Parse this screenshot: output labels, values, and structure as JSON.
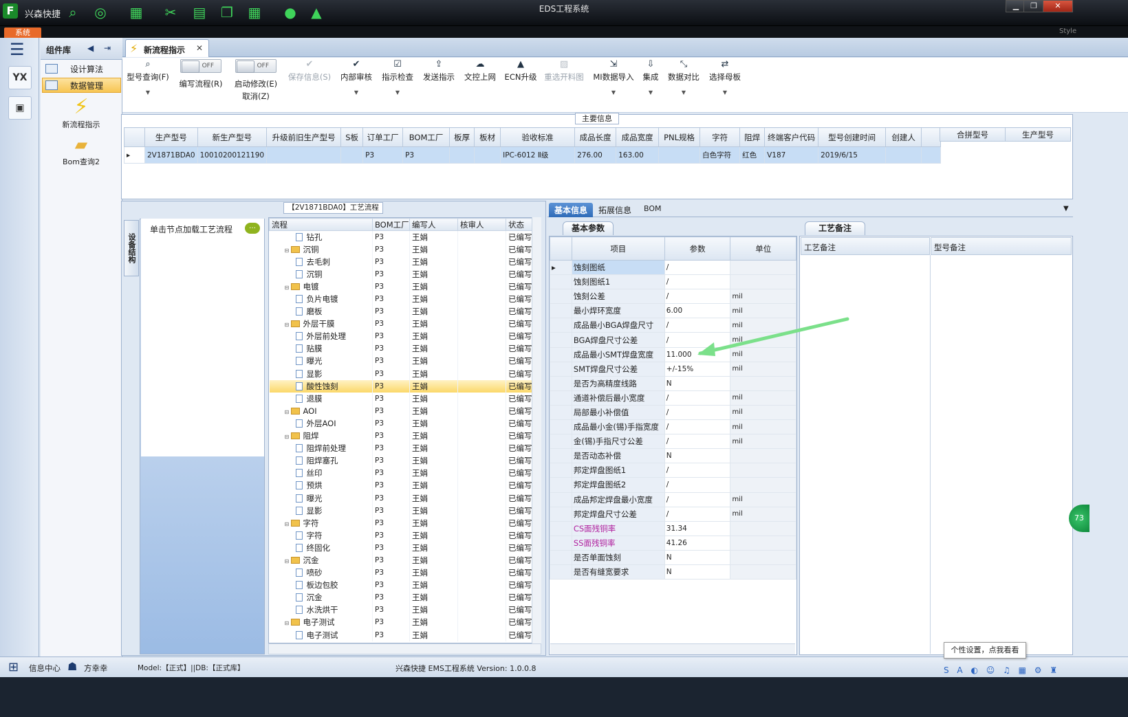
{
  "window": {
    "title": "EDS工程系统",
    "app_name": "兴森快捷",
    "logo": "F",
    "system_tab": "系统",
    "style_label": "Style"
  },
  "toolbar_icons": [
    "search-icon",
    "globe-icon",
    "grid-icon",
    "scissors-icon",
    "film-icon",
    "copy-icon",
    "apps-icon",
    "user-icon",
    "chart-icon"
  ],
  "rail": {
    "items": [
      "YX",
      "calc"
    ]
  },
  "library": {
    "title": "组件库",
    "items": [
      {
        "label": "设计算法"
      },
      {
        "label": "数据管理"
      }
    ],
    "apps": [
      {
        "label": "新流程指示"
      },
      {
        "label": "Bom查询2"
      }
    ]
  },
  "tab": {
    "label": "新流程指示"
  },
  "toolbar": {
    "query": "型号查询(F)",
    "write_flow": "编写流程(R)",
    "enable_modify": "启动修改(E)",
    "cancel": "取消(Z)",
    "toggle_off": "OFF",
    "save": "保存信息(S)",
    "internal_review": "内部审核",
    "instruction_check": "指示检查",
    "send_instruction": "发送指示",
    "doc_upload": "文控上网",
    "ecn_upgrade": "ECN升级",
    "reselect_drawing": "重选开料图",
    "mi_import": "MI数据导入",
    "integration": "集成",
    "data_compare": "数据对比",
    "select_mother": "选择母板"
  },
  "main_info": {
    "title": "主要信息",
    "columns": [
      "生产型号",
      "新生产型号",
      "升级前旧生产型号",
      "S板",
      "订单工厂",
      "BOM工厂",
      "板厚",
      "板材",
      "验收标准",
      "成品长度",
      "成品宽度",
      "PNL规格",
      "字符",
      "阻焊",
      "终端客户代码",
      "型号创建时间",
      "创建人"
    ],
    "row": [
      "2V1871BDA0",
      "10010200121190",
      "",
      "",
      "P3",
      "P3",
      "",
      "",
      "IPC-6012 Ⅱ级",
      "276.00",
      "163.00",
      "",
      "白色字符",
      "红色",
      "V187",
      "2019/6/15",
      ""
    ],
    "merge_columns": [
      "合拼型号",
      "生产型号"
    ]
  },
  "process": {
    "title": "【2V1871BDA0】工艺流程",
    "side_tab": "设备结构",
    "hint": "单击节点加载工艺流程",
    "columns": [
      "流程",
      "BOM工厂",
      "编写人",
      "核审人",
      "状态"
    ],
    "rows": [
      {
        "name": "钻孔",
        "level": 2,
        "bom": "P3",
        "writer": "王娟",
        "reviewer": "",
        "status": "已编写"
      },
      {
        "name": "沉铜",
        "level": 1,
        "bom": "P3",
        "writer": "王娟",
        "reviewer": "",
        "status": "已编写"
      },
      {
        "name": "去毛刺",
        "level": 2,
        "bom": "P3",
        "writer": "王娟",
        "reviewer": "",
        "status": "已编写"
      },
      {
        "name": "沉铜",
        "level": 2,
        "bom": "P3",
        "writer": "王娟",
        "reviewer": "",
        "status": "已编写"
      },
      {
        "name": "电镀",
        "level": 1,
        "bom": "P3",
        "writer": "王娟",
        "reviewer": "",
        "status": "已编写"
      },
      {
        "name": "负片电镀",
        "level": 2,
        "bom": "P3",
        "writer": "王娟",
        "reviewer": "",
        "status": "已编写"
      },
      {
        "name": "磨板",
        "level": 2,
        "bom": "P3",
        "writer": "王娟",
        "reviewer": "",
        "status": "已编写"
      },
      {
        "name": "外层干膜",
        "level": 1,
        "bom": "P3",
        "writer": "王娟",
        "reviewer": "",
        "status": "已编写"
      },
      {
        "name": "外层前处理",
        "level": 2,
        "bom": "P3",
        "writer": "王娟",
        "reviewer": "",
        "status": "已编写"
      },
      {
        "name": "贴膜",
        "level": 2,
        "bom": "P3",
        "writer": "王娟",
        "reviewer": "",
        "status": "已编写"
      },
      {
        "name": "曝光",
        "level": 2,
        "bom": "P3",
        "writer": "王娟",
        "reviewer": "",
        "status": "已编写"
      },
      {
        "name": "显影",
        "level": 2,
        "bom": "P3",
        "writer": "王娟",
        "reviewer": "",
        "status": "已编写"
      },
      {
        "name": "酸性蚀刻",
        "level": 2,
        "bom": "P3",
        "writer": "王娟",
        "reviewer": "",
        "status": "已编写",
        "selected": true
      },
      {
        "name": "退膜",
        "level": 2,
        "bom": "P3",
        "writer": "王娟",
        "reviewer": "",
        "status": "已编写"
      },
      {
        "name": "AOI",
        "level": 1,
        "bom": "P3",
        "writer": "王娟",
        "reviewer": "",
        "status": "已编写"
      },
      {
        "name": "外层AOI",
        "level": 2,
        "bom": "P3",
        "writer": "王娟",
        "reviewer": "",
        "status": "已编写"
      },
      {
        "name": "阻焊",
        "level": 1,
        "bom": "P3",
        "writer": "王娟",
        "reviewer": "",
        "status": "已编写"
      },
      {
        "name": "阻焊前处理",
        "level": 2,
        "bom": "P3",
        "writer": "王娟",
        "reviewer": "",
        "status": "已编写"
      },
      {
        "name": "阻焊塞孔",
        "level": 2,
        "bom": "P3",
        "writer": "王娟",
        "reviewer": "",
        "status": "已编写"
      },
      {
        "name": "丝印",
        "level": 2,
        "bom": "P3",
        "writer": "王娟",
        "reviewer": "",
        "status": "已编写"
      },
      {
        "name": "预烘",
        "level": 2,
        "bom": "P3",
        "writer": "王娟",
        "reviewer": "",
        "status": "已编写"
      },
      {
        "name": "曝光",
        "level": 2,
        "bom": "P3",
        "writer": "王娟",
        "reviewer": "",
        "status": "已编写"
      },
      {
        "name": "显影",
        "level": 2,
        "bom": "P3",
        "writer": "王娟",
        "reviewer": "",
        "status": "已编写"
      },
      {
        "name": "字符",
        "level": 1,
        "bom": "P3",
        "writer": "王娟",
        "reviewer": "",
        "status": "已编写"
      },
      {
        "name": "字符",
        "level": 2,
        "bom": "P3",
        "writer": "王娟",
        "reviewer": "",
        "status": "已编写"
      },
      {
        "name": "终固化",
        "level": 2,
        "bom": "P3",
        "writer": "王娟",
        "reviewer": "",
        "status": "已编写"
      },
      {
        "name": "沉金",
        "level": 1,
        "bom": "P3",
        "writer": "王娟",
        "reviewer": "",
        "status": "已编写"
      },
      {
        "name": "喷砂",
        "level": 2,
        "bom": "P3",
        "writer": "王娟",
        "reviewer": "",
        "status": "已编写"
      },
      {
        "name": "板边包胶",
        "level": 2,
        "bom": "P3",
        "writer": "王娟",
        "reviewer": "",
        "status": "已编写"
      },
      {
        "name": "沉金",
        "level": 2,
        "bom": "P3",
        "writer": "王娟",
        "reviewer": "",
        "status": "已编写"
      },
      {
        "name": "水洗烘干",
        "level": 2,
        "bom": "P3",
        "writer": "王娟",
        "reviewer": "",
        "status": "已编写"
      },
      {
        "name": "电子测试",
        "level": 1,
        "bom": "P3",
        "writer": "王娟",
        "reviewer": "",
        "status": "已编写"
      },
      {
        "name": "电子测试",
        "level": 2,
        "bom": "P3",
        "writer": "王娟",
        "reviewer": "",
        "status": "已编写"
      }
    ]
  },
  "info_tabs": [
    "基本信息",
    "拓展信息",
    "BOM"
  ],
  "basic_params": {
    "title": "基本参数",
    "columns": [
      "项目",
      "参数",
      "单位"
    ],
    "rows": [
      {
        "item": "蚀刻图纸",
        "value": "/",
        "unit": "",
        "current": true
      },
      {
        "item": "蚀刻图纸1",
        "value": "/",
        "unit": ""
      },
      {
        "item": "蚀刻公差",
        "value": "/",
        "unit": "mil"
      },
      {
        "item": "最小焊环宽度",
        "value": "6.00",
        "unit": "mil"
      },
      {
        "item": "成品最小BGA焊盘尺寸",
        "value": "/",
        "unit": "mil"
      },
      {
        "item": "BGA焊盘尺寸公差",
        "value": "/",
        "unit": "mil"
      },
      {
        "item": "成品最小SMT焊盘宽度",
        "value": "11.000",
        "unit": "mil"
      },
      {
        "item": "SMT焊盘尺寸公差",
        "value": "+/-15%",
        "unit": "mil"
      },
      {
        "item": "是否为高精度线路",
        "value": "N",
        "unit": ""
      },
      {
        "item": "通道补偿后最小宽度",
        "value": "/",
        "unit": "mil"
      },
      {
        "item": "局部最小补偿值",
        "value": "/",
        "unit": "mil"
      },
      {
        "item": "成品最小金(锡)手指宽度",
        "value": "/",
        "unit": "mil"
      },
      {
        "item": "金(锡)手指尺寸公差",
        "value": "/",
        "unit": "mil"
      },
      {
        "item": "是否动态补偿",
        "value": "N",
        "unit": ""
      },
      {
        "item": "邦定焊盘图纸1",
        "value": "/",
        "unit": ""
      },
      {
        "item": "邦定焊盘图纸2",
        "value": "/",
        "unit": ""
      },
      {
        "item": "成品邦定焊盘最小宽度",
        "value": "/",
        "unit": "mil"
      },
      {
        "item": "邦定焊盘尺寸公差",
        "value": "/",
        "unit": "mil"
      },
      {
        "item": "CS面残铜率",
        "value": "31.34",
        "unit": "",
        "purple": true
      },
      {
        "item": "SS面残铜率",
        "value": "41.26",
        "unit": "",
        "purple": true
      },
      {
        "item": "是否单面蚀刻",
        "value": "N",
        "unit": ""
      },
      {
        "item": "是否有缝宽要求",
        "value": "N",
        "unit": ""
      }
    ]
  },
  "remarks": {
    "title": "工艺备注",
    "col1": "工艺备注",
    "col2": "型号备注"
  },
  "status": {
    "info_center": "信息中心",
    "user": "方幸幸",
    "model": "Model:【正式】||DB:【正式库】",
    "version": "兴森快捷 EMS工程系统 Version: 1.0.0.8",
    "tooltip": "个性设置，点我看看",
    "badge": "73"
  },
  "colors": {
    "accent": "#2f6bb8",
    "highlight": "#fbd86a",
    "arrow": "#7be08a"
  }
}
